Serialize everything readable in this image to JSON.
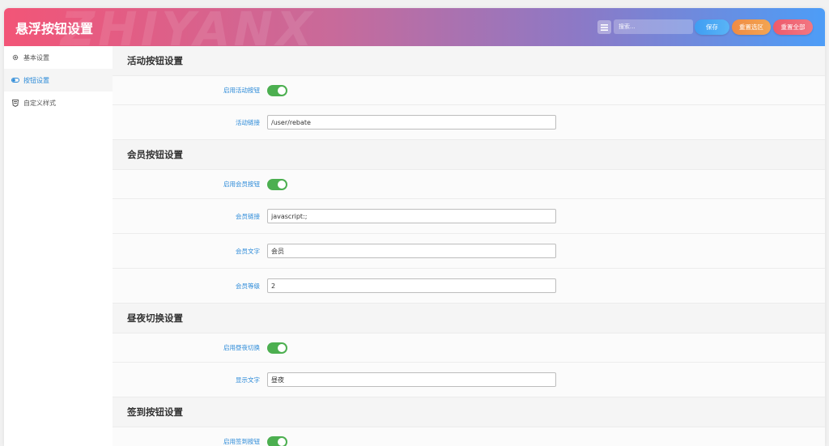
{
  "header": {
    "title": "悬浮按钮设置",
    "watermark": "ZHIYANX",
    "search_placeholder": "搜索...",
    "save_label": "保存",
    "reset_section_label": "重置选区",
    "reset_all_label": "重置全部"
  },
  "sidebar": {
    "items": [
      {
        "label": "基本设置",
        "icon": "gear-icon",
        "active": false
      },
      {
        "label": "按钮设置",
        "icon": "toggle-icon",
        "active": true
      },
      {
        "label": "自定义样式",
        "icon": "css3-icon",
        "active": false
      }
    ]
  },
  "sections": {
    "activity": {
      "title": "活动按钮设置",
      "enable_label": "启用活动按钮",
      "enable_on": true,
      "link_label": "活动链接",
      "link_value": "/user/rebate"
    },
    "member": {
      "title": "会员按钮设置",
      "enable_label": "启用会员按钮",
      "enable_on": true,
      "link_label": "会员链接",
      "link_value": "javascript:;",
      "text_label": "会员文字",
      "text_value": "会员",
      "level_label": "会员等级",
      "level_value": "2"
    },
    "daynight": {
      "title": "昼夜切换设置",
      "enable_label": "启用昼夜切换",
      "enable_on": true,
      "text_label": "显示文字",
      "text_value": "昼夜"
    },
    "signin": {
      "title": "签到按钮设置",
      "enable_label": "启用签到按钮",
      "enable_on": true
    }
  },
  "colors": {
    "accent": "#2b8ad8",
    "toggle_on": "#4caf50"
  }
}
